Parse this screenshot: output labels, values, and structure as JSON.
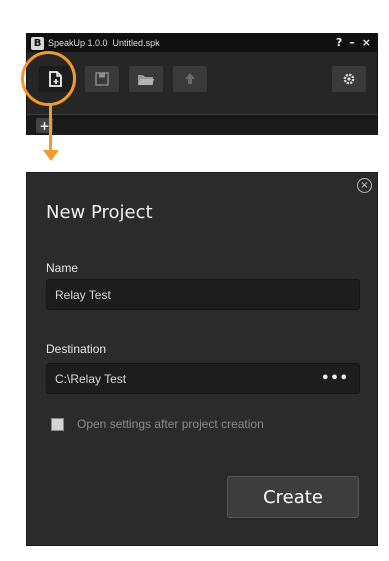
{
  "app": {
    "logo_text": "B",
    "name": "SpeakUp 1.0.0",
    "file": "Untitled.spk",
    "controls": {
      "help": "?",
      "minimize": "–",
      "close": "×"
    }
  },
  "toolbar": {
    "buttons": [
      {
        "icon": "new-file-icon",
        "state": "active"
      },
      {
        "icon": "save-icon"
      },
      {
        "icon": "open-folder-icon"
      },
      {
        "icon": "upload-icon"
      },
      {
        "icon": "gear-icon"
      }
    ],
    "add_tab_label": "+"
  },
  "callout": {
    "color": "#f39a2a"
  },
  "dialog": {
    "title": "New Project",
    "close_label": "×",
    "name_label": "Name",
    "name_value": "Relay Test",
    "destination_label": "Destination",
    "destination_value": "C:\\Relay Test",
    "browse_label": "•••",
    "checkbox_label": "Open settings after project creation",
    "checkbox_checked": false,
    "create_label": "Create"
  }
}
